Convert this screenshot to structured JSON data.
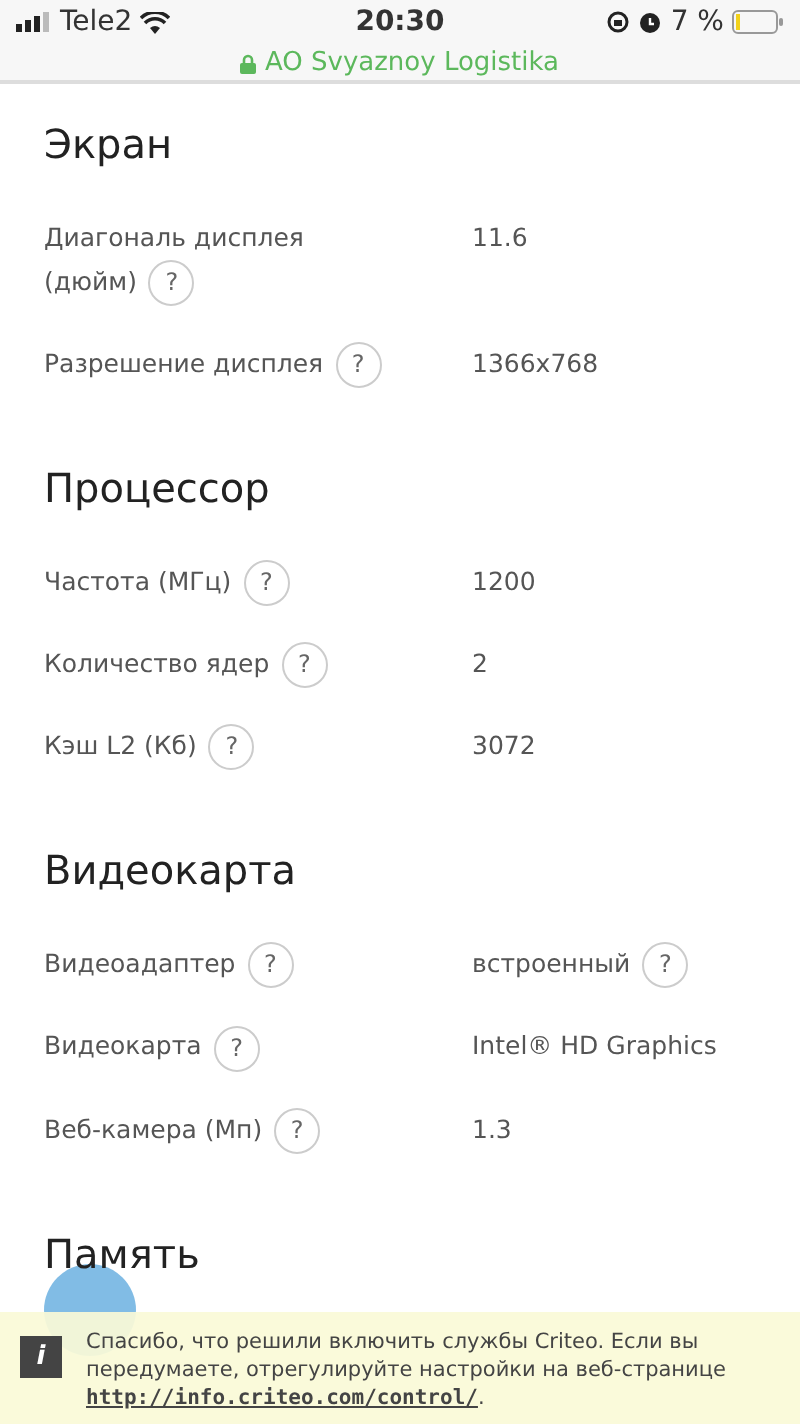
{
  "status_bar": {
    "carrier": "Tele2",
    "time": "20:30",
    "battery": "7 %"
  },
  "address_bar": {
    "site": "AO Svyaznoy Logistika",
    "secure": true
  },
  "sections": [
    {
      "title": "Экран",
      "specs": [
        {
          "label_lines": [
            "Диагональ дисплея",
            "(дюйм)"
          ],
          "hint": "?",
          "value": "11.6"
        },
        {
          "label": "Разрешение дисплея",
          "hint": "?",
          "value": "1366x768"
        }
      ]
    },
    {
      "title": "Процессор",
      "specs": [
        {
          "label": "Частота (МГц)",
          "hint": "?",
          "value": "1200"
        },
        {
          "label": "Количество ядер",
          "hint": "?",
          "value": "2"
        },
        {
          "label": "Кэш L2 (Кб)",
          "hint": "?",
          "value": "3072"
        }
      ]
    },
    {
      "title": "Видеокарта",
      "specs": [
        {
          "label": "Видеоадаптер",
          "hint": "?",
          "value": "встроенный",
          "value_hint": "?"
        },
        {
          "label": "Видеокарта",
          "hint": "?",
          "value": "Intel® HD Graphics"
        },
        {
          "label": "Веб-камера (Мп)",
          "hint": "?",
          "value": "1.3"
        }
      ]
    },
    {
      "title": "Память"
    }
  ],
  "notice": {
    "icon": "i",
    "text": "Спасибо, что решили включить службы Criteo. Если вы передумаете, отрегулируйте настройки на веб-странице",
    "link": "http://info.criteo.com/control/",
    "after": "."
  }
}
